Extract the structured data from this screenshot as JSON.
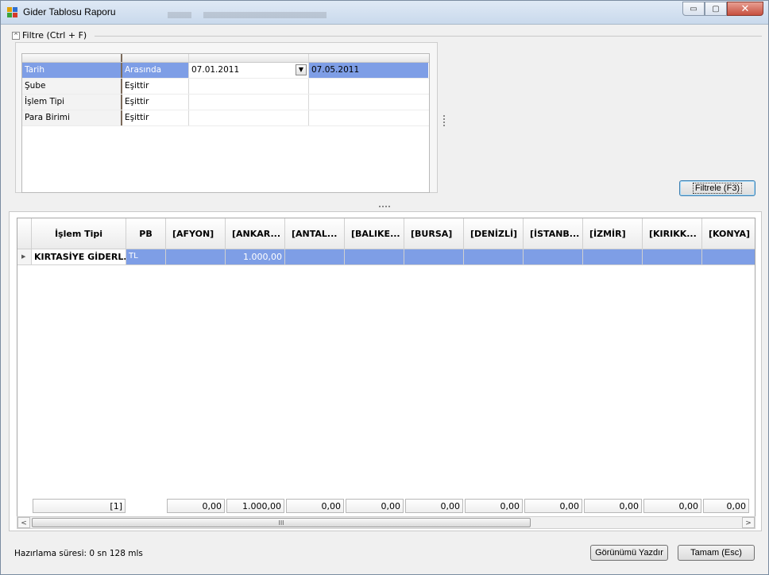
{
  "window": {
    "title": "Gider Tablosu Raporu",
    "controls": {
      "minimize": "▭",
      "maximize": "▢",
      "close": "✕"
    }
  },
  "filter": {
    "header": "Filtre (Ctrl + F)",
    "collapse_glyph": "^",
    "rows": [
      {
        "field": "Tarih",
        "operator": "Arasında",
        "value1": "07.01.2011",
        "value2": "07.05.2011",
        "selected": true
      },
      {
        "field": "Şube",
        "operator": "Eşittir",
        "value1": "",
        "value2": ""
      },
      {
        "field": "İşlem Tipi",
        "operator": "Eşittir",
        "value1": "",
        "value2": ""
      },
      {
        "field": "Para Birimi",
        "operator": "Eşittir",
        "value1": "",
        "value2": ""
      }
    ],
    "apply_button": "Filtrele (F3)"
  },
  "grid": {
    "columns": [
      "İşlem Tipi",
      "PB",
      "[AFYON]",
      "[ANKAR...",
      "[ANTAL...",
      "[BALIKE...",
      "[BURSA]",
      "[DENİZLİ]",
      "[İSTANB...",
      "[İZMİR]",
      "[KIRIKK...",
      "[KONYA]"
    ],
    "rows": [
      {
        "cells": [
          "KIRTASİYE GİDERL...",
          "TL",
          "",
          "1.000,00",
          "",
          "",
          "",
          "",
          "",
          "",
          "",
          ""
        ]
      }
    ],
    "footer": [
      "[1]",
      "",
      "0,00",
      "1.000,00",
      "0,00",
      "0,00",
      "0,00",
      "0,00",
      "0,00",
      "0,00",
      "0,00",
      "0,00"
    ],
    "scroll_thumb_glyph": "III",
    "scroll_left_glyph": "<",
    "scroll_right_glyph": ">",
    "row_indicator_glyph": "▶"
  },
  "status": {
    "text": "Hazırlama süresi: 0 sn 128 mls"
  },
  "buttons": {
    "print": "Görünümü Yazdır",
    "ok": "Tamam (Esc)"
  },
  "colors": {
    "selection": "#7e9ee6",
    "title_bar": "#dfe9f5",
    "close_button": "#c7503f"
  }
}
